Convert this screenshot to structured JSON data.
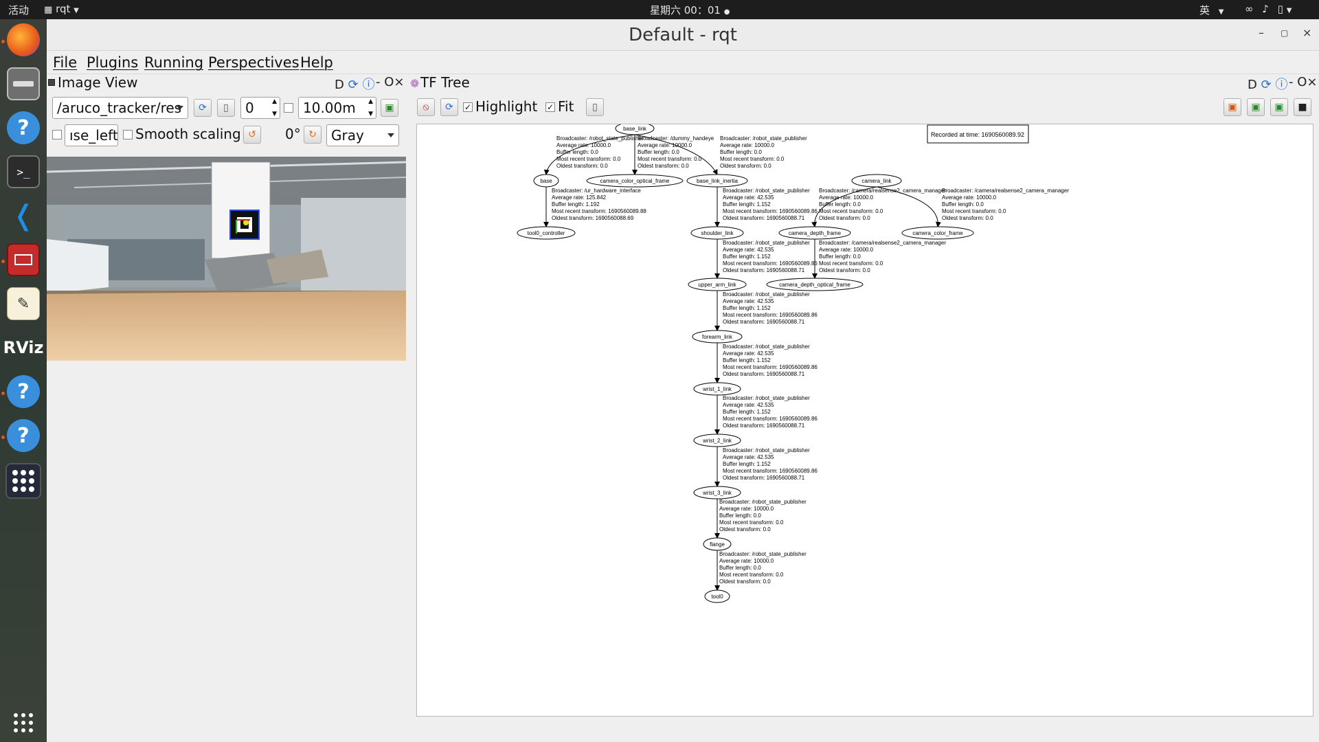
{
  "topbar": {
    "activities": "活动",
    "app_menu": "rqt",
    "clock": "星期六 00：01",
    "input_method": "英"
  },
  "dock": {
    "items": [
      {
        "name": "firefox-icon"
      },
      {
        "name": "files-icon"
      },
      {
        "name": "help-icon"
      },
      {
        "name": "terminal-icon"
      },
      {
        "name": "vscode-icon"
      },
      {
        "name": "app-red-icon"
      },
      {
        "name": "text-editor-icon"
      },
      {
        "name": "rviz-icon",
        "label": "RViz"
      },
      {
        "name": "help-icon"
      },
      {
        "name": "help-icon"
      },
      {
        "name": "rqt-grid-icon"
      }
    ]
  },
  "window": {
    "title": "Default - rqt",
    "menus": [
      "File",
      "Plugins",
      "Running",
      "Perspectives",
      "Help"
    ]
  },
  "image_view": {
    "title": "Image View",
    "dock_controls": "D",
    "close_controls": "- O",
    "topic": "/aruco_tracker/res",
    "spin_value": "0",
    "max_value": "10.00m",
    "mouse_topic": "ıse_left",
    "smooth_scaling_label": "Smooth scaling",
    "rotation": "0°",
    "colormap": "Gray"
  },
  "tf_tree": {
    "title": "TF Tree",
    "dock_controls": "D",
    "close_controls": "- O",
    "highlight_label": "Highlight",
    "fit_label": "Fit",
    "recorded": "Recorded at time: 1690560089.92",
    "nodes": {
      "base_link": "base_link",
      "base": "base",
      "camera_color_optical_frame": "camera_color_optical_frame",
      "base_link_inertia": "base_link_inertia",
      "camera_link": "camera_link",
      "tool0_controller": "tool0_controller",
      "shoulder_link": "shoulder_link",
      "camera_depth_frame": "camera_depth_frame",
      "camera_color_frame": "camera_color_frame",
      "upper_arm_link": "upper_arm_link",
      "camera_depth_optical_frame": "camera_depth_optical_frame",
      "forearm_link": "forearm_link",
      "wrist_1_link": "wrist_1_link",
      "wrist_2_link": "wrist_2_link",
      "wrist_3_link": "wrist_3_link",
      "flange": "flange",
      "tool0": "tool0"
    },
    "edges": [
      {
        "lines": [
          "Broadcaster: /robot_state_publisher",
          "Average rate: 10000.0",
          "Buffer length: 0.0",
          "Most recent transform: 0.0",
          "Oldest transform: 0.0"
        ]
      },
      {
        "lines": [
          "Broadcaster: /dummy_handeye",
          "Average rate: 10000.0",
          "Buffer length: 0.0",
          "Most recent transform: 0.0",
          "Oldest transform: 0.0"
        ]
      },
      {
        "lines": [
          "Broadcaster: /robot_state_publisher",
          "Average rate: 10000.0",
          "Buffer length: 0.0",
          "Most recent transform: 0.0",
          "Oldest transform: 0.0"
        ]
      },
      {
        "lines": [
          "Broadcaster: /ur_hardware_interface",
          "Average rate: 125.842",
          "Buffer length: 1.192",
          "Most recent transform: 1690560089.88",
          "Oldest transform: 1690560088.69"
        ]
      },
      {
        "lines": [
          "Broadcaster: /robot_state_publisher",
          "Average rate: 42.535",
          "Buffer length: 1.152",
          "Most recent transform: 1690560089.86",
          "Oldest transform: 1690560088.71"
        ]
      },
      {
        "lines": [
          "Broadcaster: /camera/realsense2_camera_manager",
          "Average rate: 10000.0",
          "Buffer length: 0.0",
          "Most recent transform: 0.0",
          "Oldest transform: 0.0"
        ]
      },
      {
        "lines": [
          "Broadcaster: /camera/realsense2_camera_manager",
          "Average rate: 10000.0",
          "Buffer length: 0.0",
          "Most recent transform: 0.0",
          "Oldest transform: 0.0"
        ]
      },
      {
        "lines": [
          "Broadcaster: /robot_state_publisher",
          "Average rate: 42.535",
          "Buffer length: 1.152",
          "Most recent transform: 1690560089.86",
          "Oldest transform: 1690560088.71"
        ]
      },
      {
        "lines": [
          "Broadcaster: /camera/realsense2_camera_manager",
          "Average rate: 10000.0",
          "Buffer length: 0.0",
          "Most recent transform: 0.0",
          "Oldest transform: 0.0"
        ]
      },
      {
        "lines": [
          "Broadcaster: /robot_state_publisher",
          "Average rate: 42.535",
          "Buffer length: 1.152",
          "Most recent transform: 1690560089.86",
          "Oldest transform: 1690560088.71"
        ]
      },
      {
        "lines": [
          "Broadcaster: /robot_state_publisher",
          "Average rate: 42.535",
          "Buffer length: 1.152",
          "Most recent transform: 1690560089.86",
          "Oldest transform: 1690560088.71"
        ]
      },
      {
        "lines": [
          "Broadcaster: /robot_state_publisher",
          "Average rate: 42.535",
          "Buffer length: 1.152",
          "Most recent transform: 1690560089.86",
          "Oldest transform: 1690560088.71"
        ]
      },
      {
        "lines": [
          "Broadcaster: /robot_state_publisher",
          "Average rate: 42.535",
          "Buffer length: 1.152",
          "Most recent transform: 1690560089.86",
          "Oldest transform: 1690560088.71"
        ]
      },
      {
        "lines": [
          "Broadcaster: /robot_state_publisher",
          "Average rate: 10000.0",
          "Buffer length: 0.0",
          "Most recent transform: 0.0",
          "Oldest transform: 0.0"
        ]
      },
      {
        "lines": [
          "Broadcaster: /robot_state_publisher",
          "Average rate: 10000.0",
          "Buffer length: 0.0",
          "Most recent transform: 0.0",
          "Oldest transform: 0.0"
        ]
      }
    ]
  },
  "colors": {
    "ubuntu_orange": "#e95420",
    "topbar": "#1d1d1d",
    "window_bg": "#efefef"
  }
}
